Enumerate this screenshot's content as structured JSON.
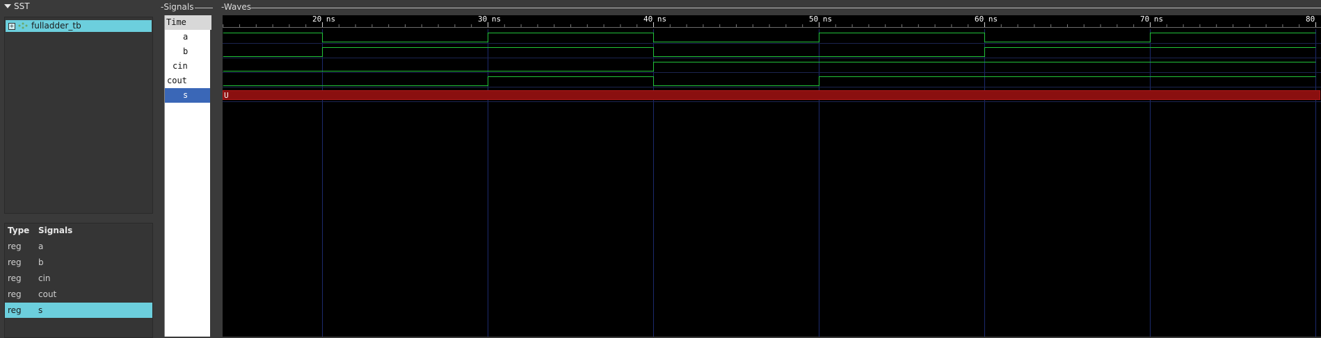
{
  "sst": {
    "title": "SST",
    "tree_item": "fulladder_tb"
  },
  "signal_list": {
    "col_type": "Type",
    "col_signals": "Signals",
    "rows": [
      {
        "type": "reg",
        "name": "a"
      },
      {
        "type": "reg",
        "name": "b"
      },
      {
        "type": "reg",
        "name": "cin"
      },
      {
        "type": "reg",
        "name": "cout"
      },
      {
        "type": "reg",
        "name": "s",
        "selected": true
      }
    ]
  },
  "signals_pane": {
    "title": "-Signals",
    "time_label": "Time",
    "names": [
      "a",
      "b",
      "cin",
      "cout",
      "s"
    ]
  },
  "waves_pane": {
    "title": "-Waves",
    "time_labels": [
      "20 ns",
      "30 ns",
      "40 ns",
      "50 ns",
      "60 ns",
      "70 ns",
      "80"
    ],
    "s_value": "U"
  },
  "colors": {
    "accent": "#6ccfdd",
    "selected_signal": "#3a67b7",
    "wave_green": "#22c43a",
    "undefined_red": "#8a0f0f",
    "grid_blue": "#1c2a6e"
  },
  "chart_data": {
    "type": "line",
    "x_unit": "ns",
    "xlim": [
      14,
      80
    ],
    "series": [
      {
        "name": "a",
        "values": [
          [
            14,
            1
          ],
          [
            20,
            0
          ],
          [
            30,
            1
          ],
          [
            40,
            0
          ],
          [
            50,
            1
          ],
          [
            60,
            0
          ],
          [
            70,
            1
          ],
          [
            80,
            1
          ]
        ]
      },
      {
        "name": "b",
        "values": [
          [
            14,
            0
          ],
          [
            20,
            1
          ],
          [
            40,
            0
          ],
          [
            60,
            1
          ],
          [
            80,
            1
          ]
        ]
      },
      {
        "name": "cin",
        "values": [
          [
            14,
            0
          ],
          [
            40,
            1
          ],
          [
            80,
            1
          ]
        ]
      },
      {
        "name": "cout",
        "values": [
          [
            14,
            0
          ],
          [
            30,
            1
          ],
          [
            40,
            0
          ],
          [
            50,
            1
          ],
          [
            80,
            1
          ]
        ]
      }
    ]
  }
}
